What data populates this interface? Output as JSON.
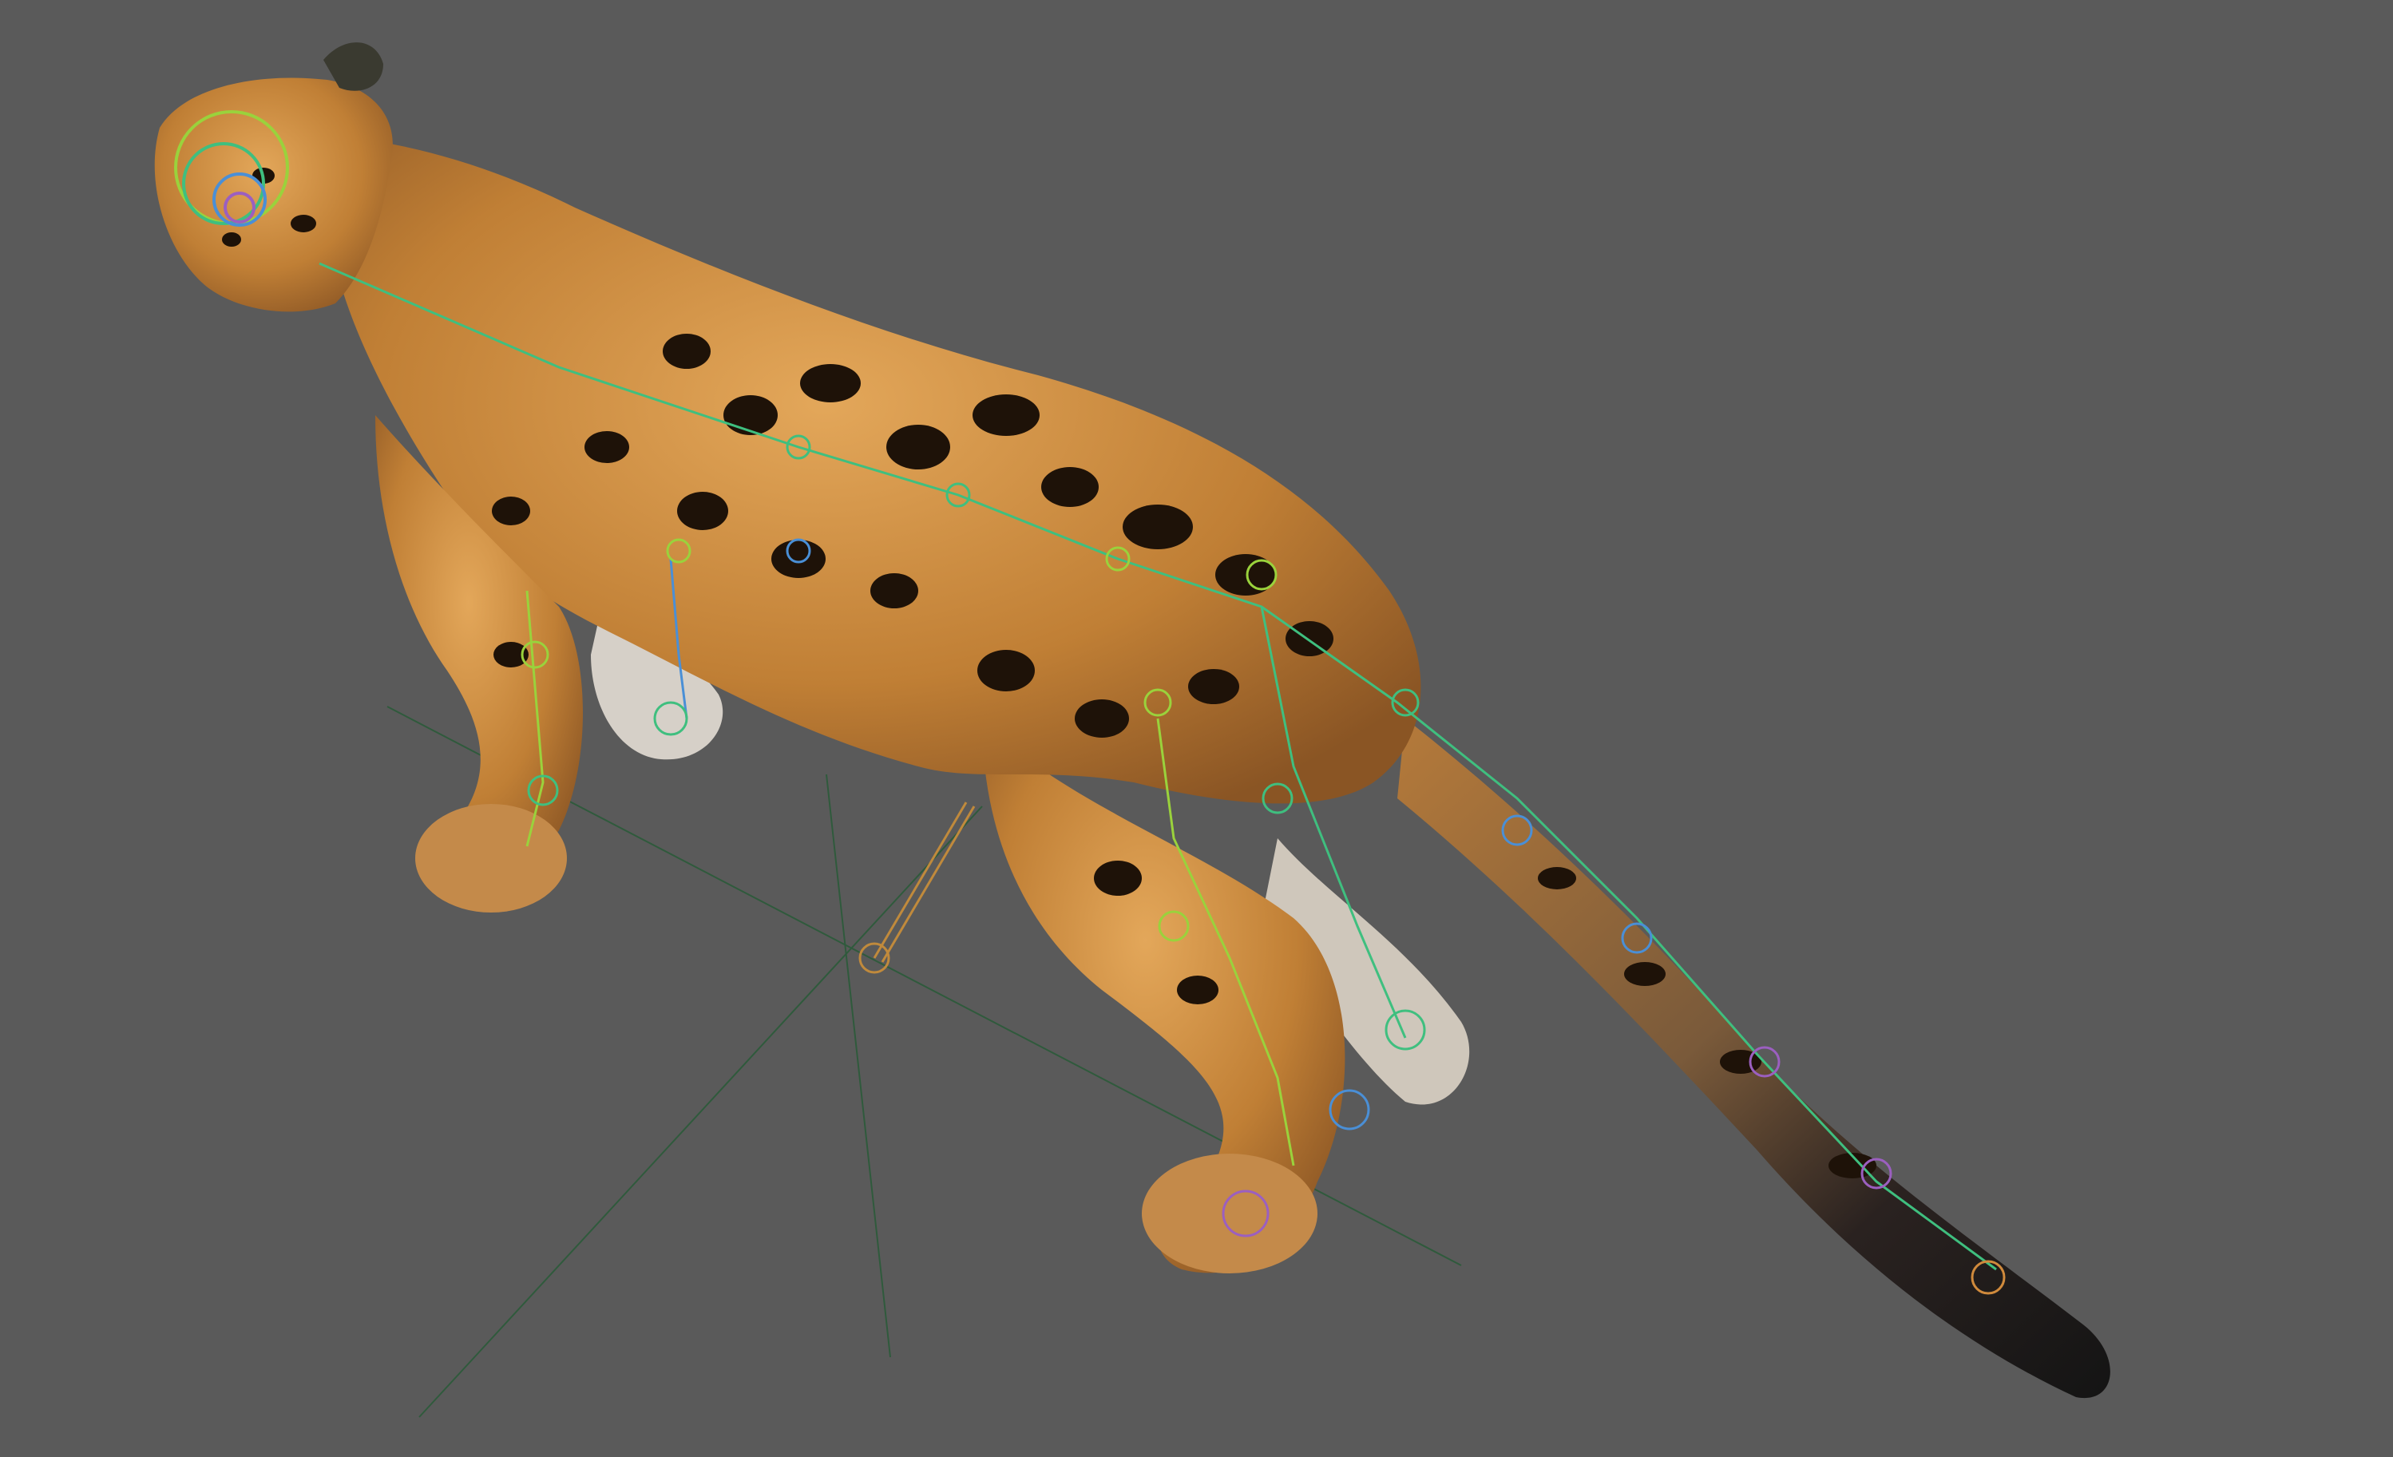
{
  "viewport": {
    "background_color": "#5a5a5a",
    "grid_color": "#2f5a3c"
  },
  "model": {
    "fur_color": "#c88a3e",
    "fur_light": "#e0b070",
    "spot_color": "#1e1208",
    "tail_tip_color": "#141414",
    "underside_color": "#ddd6cc"
  },
  "rig": {
    "control_colors": [
      "#9ad23c",
      "#3fbf7f",
      "#4a8fd6",
      "#9b5fc0",
      "#d08a3c"
    ]
  }
}
